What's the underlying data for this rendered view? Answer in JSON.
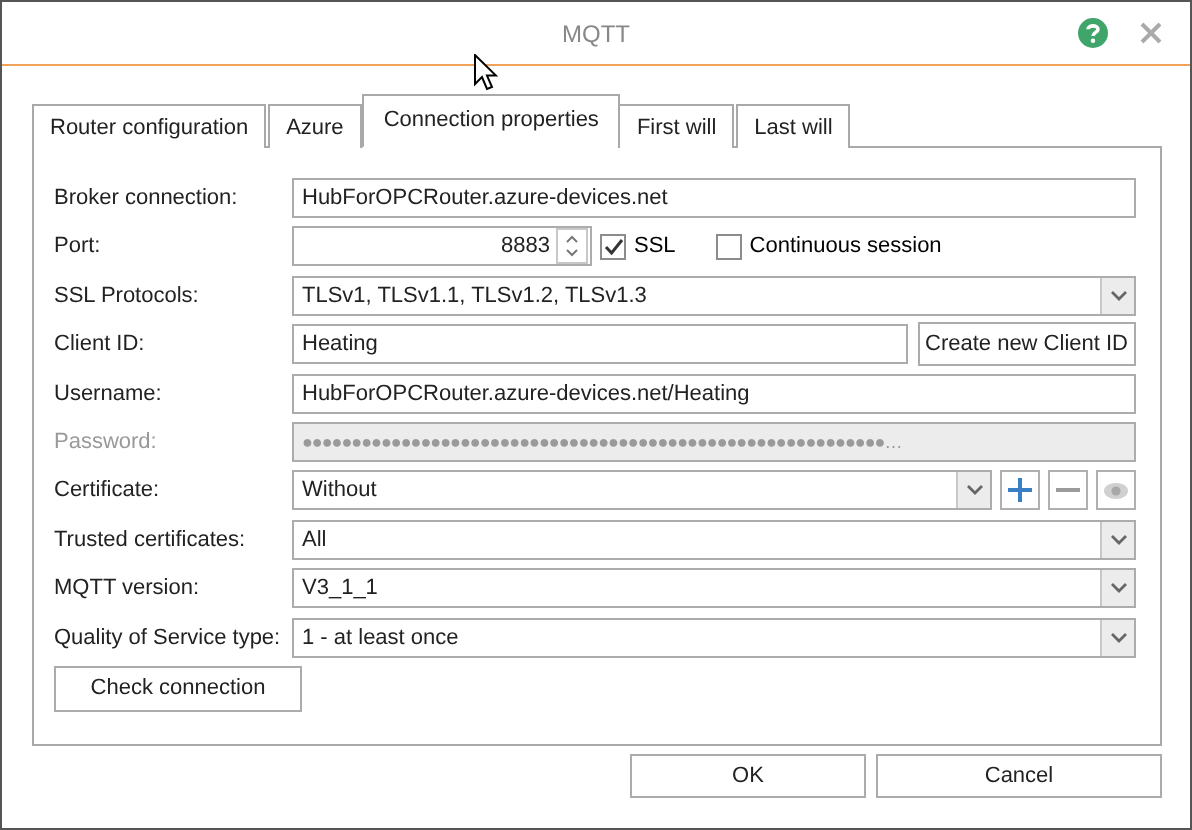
{
  "window": {
    "title": "MQTT"
  },
  "tabs": [
    {
      "label": "Router configuration",
      "selected": false
    },
    {
      "label": "Azure",
      "selected": false
    },
    {
      "label": "Connection properties",
      "selected": true
    },
    {
      "label": "First will",
      "selected": false
    },
    {
      "label": "Last will",
      "selected": false
    }
  ],
  "rows": [
    {
      "kind": "text",
      "label": "Broker connection:",
      "value": "HubForOPCRouter.azure-devices.net",
      "disabled": false
    },
    {
      "kind": "port",
      "label": "Port:",
      "value": "8883",
      "disabled": false,
      "options": [
        {
          "label": "SSL",
          "checked": true
        },
        {
          "label": "Continuous session",
          "checked": false
        }
      ]
    },
    {
      "kind": "combo",
      "label": "SSL Protocols:",
      "value": "TLSv1, TLSv1.1, TLSv1.2, TLSv1.3",
      "disabled": false
    },
    {
      "kind": "text-button",
      "label": "Client ID:",
      "value": "Heating",
      "button": "Create new Client ID",
      "disabled": false
    },
    {
      "kind": "text",
      "label": "Username:",
      "value": "HubForOPCRouter.azure-devices.net/Heating",
      "disabled": false
    },
    {
      "kind": "text",
      "label": "Password:",
      "value": "●●●●●●●●●●●●●●●●●●●●●●●●●●●●●●●●●●●●●●●●●●●●●●●●●●●●●●●●●●●…",
      "disabled": true
    },
    {
      "kind": "certificate",
      "label": "Certificate:",
      "value": "Without",
      "disabled": false
    },
    {
      "kind": "combo",
      "label": "Trusted certificates:",
      "value": "All",
      "disabled": false
    },
    {
      "kind": "combo",
      "label": "MQTT version:",
      "value": "V3_1_1",
      "disabled": false
    },
    {
      "kind": "combo",
      "label": "Quality of Service type:",
      "value": "1 - at least once",
      "disabled": false
    }
  ],
  "check_button": "Check connection",
  "buttons": [
    "OK",
    "Cancel"
  ]
}
